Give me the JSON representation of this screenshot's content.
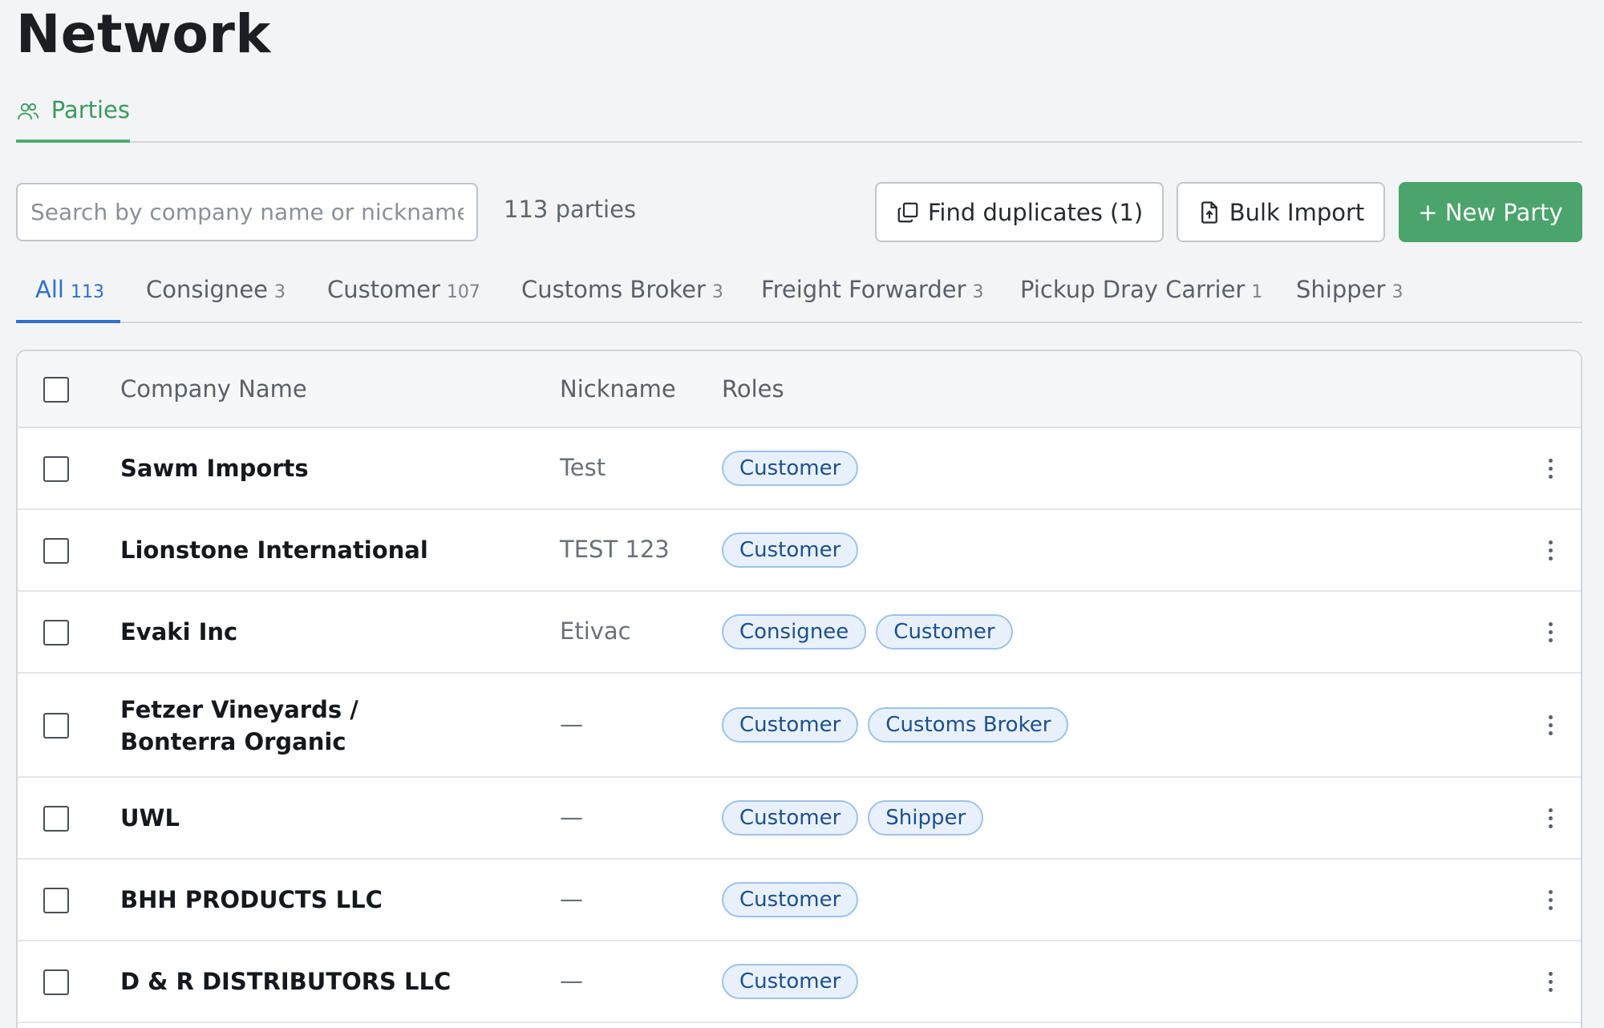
{
  "page": {
    "title": "Network"
  },
  "page_tabs": [
    {
      "label": "Parties",
      "icon": "users-icon",
      "active": true
    }
  ],
  "toolbar": {
    "search_placeholder": "Search by company name or nickname",
    "party_count": "113 parties",
    "find_duplicates_label": "Find duplicates (1)",
    "bulk_import_label": "Bulk Import",
    "new_party_label": "+ New Party"
  },
  "filter_tabs": [
    {
      "label": "All",
      "count": "113",
      "active": true
    },
    {
      "label": "Consignee",
      "count": "3"
    },
    {
      "label": "Customer",
      "count": "107"
    },
    {
      "label": "Customs Broker",
      "count": "3"
    },
    {
      "label": "Freight Forwarder",
      "count": "3"
    },
    {
      "label": "Pickup Dray Carrier",
      "count": "1"
    },
    {
      "label": "Shipper",
      "count": "3"
    }
  ],
  "table": {
    "columns": [
      "Company Name",
      "Nickname",
      "Roles"
    ],
    "rows": [
      {
        "company": "Sawm Imports",
        "nickname": "Test",
        "roles": [
          "Customer"
        ]
      },
      {
        "company": "Lionstone International",
        "nickname": "TEST 123",
        "roles": [
          "Customer"
        ]
      },
      {
        "company": "Evaki Inc",
        "nickname": "Etivac",
        "roles": [
          "Consignee",
          "Customer"
        ]
      },
      {
        "company": "Fetzer Vineyards / Bonterra Organic",
        "nickname": "—",
        "roles": [
          "Customer",
          "Customs Broker"
        ]
      },
      {
        "company": "UWL",
        "nickname": "—",
        "roles": [
          "Customer",
          "Shipper"
        ]
      },
      {
        "company": "BHH PRODUCTS LLC",
        "nickname": "—",
        "roles": [
          "Customer"
        ]
      },
      {
        "company": "D & R DISTRIBUTORS LLC",
        "nickname": "—",
        "roles": [
          "Customer"
        ]
      }
    ]
  },
  "colors": {
    "accent_green": "#4aa46b",
    "accent_blue": "#2f6fcf",
    "tag_bg": "#e8f1fb"
  }
}
